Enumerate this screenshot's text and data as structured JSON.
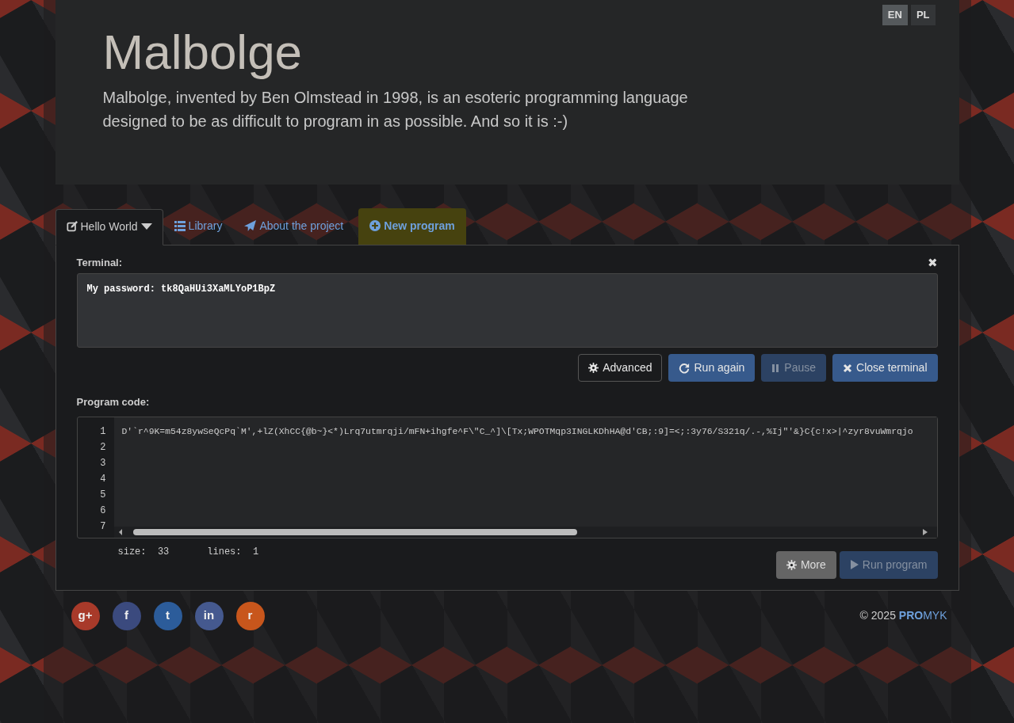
{
  "languages": [
    {
      "label": "EN",
      "selected": true
    },
    {
      "label": "PL",
      "selected": false
    }
  ],
  "header": {
    "title": "Malbolge",
    "description": "Malbolge, invented by Ben Olmstead in 1998, is an esoteric programming language designed to be as difficult to program in as possible. And so it is :-)"
  },
  "tabs": [
    {
      "label": "Hello World",
      "kind": "dropdown",
      "selected": true
    },
    {
      "label": "Library",
      "kind": "list",
      "selected": false
    },
    {
      "label": "About the project",
      "kind": "plane",
      "selected": false
    },
    {
      "label": "New program",
      "kind": "new",
      "selected": false
    }
  ],
  "terminal": {
    "label": "Terminal:",
    "close": "✖",
    "output": "My password: tk8QaHUi3XaMLYoP1BpZ"
  },
  "terminal_buttons": [
    {
      "label": "Advanced",
      "kind": "gear",
      "disabled": false
    },
    {
      "label": "Run again",
      "kind": "refresh",
      "disabled": false
    },
    {
      "label": "Pause",
      "kind": "pause",
      "disabled": true
    },
    {
      "label": "Close terminal",
      "kind": "close",
      "disabled": false
    }
  ],
  "code": {
    "label": "Program code:",
    "line_numbers": [
      "1",
      "2",
      "3",
      "4",
      "5",
      "6",
      "7"
    ],
    "text": "D'`r^9K=m54z8ywSeQcPq`M',+lZ(XhCC{@b~}<*)Lrq7utmrqji/mFN+ihgfe^F\\\"C_^]\\[Tx;WPOTMqp3INGLKDhHA@d'CB;:9]=<;:3y76/S321q/.-,%Ij\"'&}C{c!x>|^zyr8vuWmrqjo"
  },
  "stats": [
    {
      "label": "size:",
      "value": "33"
    },
    {
      "label": "lines:",
      "value": "1"
    }
  ],
  "code_buttons": [
    {
      "label": "More",
      "kind": "gear",
      "disabled": false
    },
    {
      "label": "Run program",
      "kind": "play",
      "disabled": true
    }
  ],
  "social": [
    {
      "label": "g+",
      "color": "#a83a2a"
    },
    {
      "label": "f",
      "color": "#3b4a7e"
    },
    {
      "label": "t",
      "color": "#2c5c9a"
    },
    {
      "label": "in",
      "color": "#45598f"
    },
    {
      "label": "r",
      "color": "#c8561c"
    }
  ],
  "footer": {
    "year": "© 2025",
    "brand_bold": "PRO",
    "brand_rest": "MYK"
  }
}
